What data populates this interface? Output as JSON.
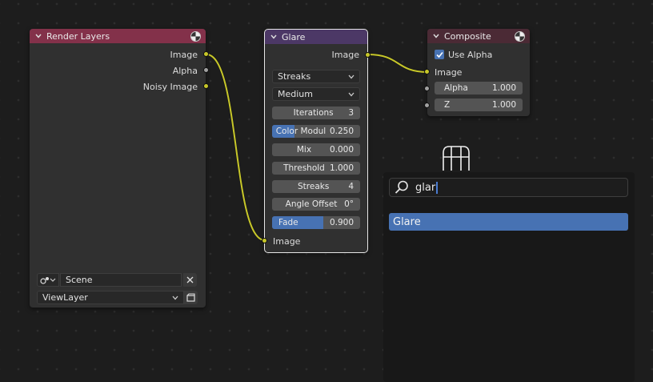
{
  "render_layers": {
    "title": "Render Layers",
    "outputs": [
      "Image",
      "Alpha",
      "Noisy Image"
    ],
    "scene": "Scene",
    "view_layer": "ViewLayer"
  },
  "glare": {
    "title": "Glare",
    "output": "Image",
    "input": "Image",
    "type": "Streaks",
    "quality": "Medium",
    "fields": [
      {
        "label": "Iterations",
        "value": "3"
      },
      {
        "label": "Color Modul",
        "value": "0.250",
        "fill": 0.25
      },
      {
        "label": "Mix",
        "value": "0.000"
      },
      {
        "label": "Threshold",
        "value": "1.000"
      },
      {
        "label": "Streaks",
        "value": "4"
      },
      {
        "label": "Angle Offset",
        "value": "0°"
      },
      {
        "label": "Fade",
        "value": "0.900",
        "fill": 0.9
      }
    ]
  },
  "composite": {
    "title": "Composite",
    "use_alpha_label": "Use Alpha",
    "use_alpha": true,
    "input": "Image",
    "fields": [
      {
        "label": "Alpha",
        "value": "1.000"
      },
      {
        "label": "Z",
        "value": "1.000"
      }
    ]
  },
  "search": {
    "query": "glar",
    "results": [
      "Glare"
    ]
  },
  "colors": {
    "render_header": "#83314a",
    "glare_header": "#4c3866",
    "composite_header": "#4b2a35",
    "link": "#c7c729",
    "highlight": "#4772b3"
  }
}
